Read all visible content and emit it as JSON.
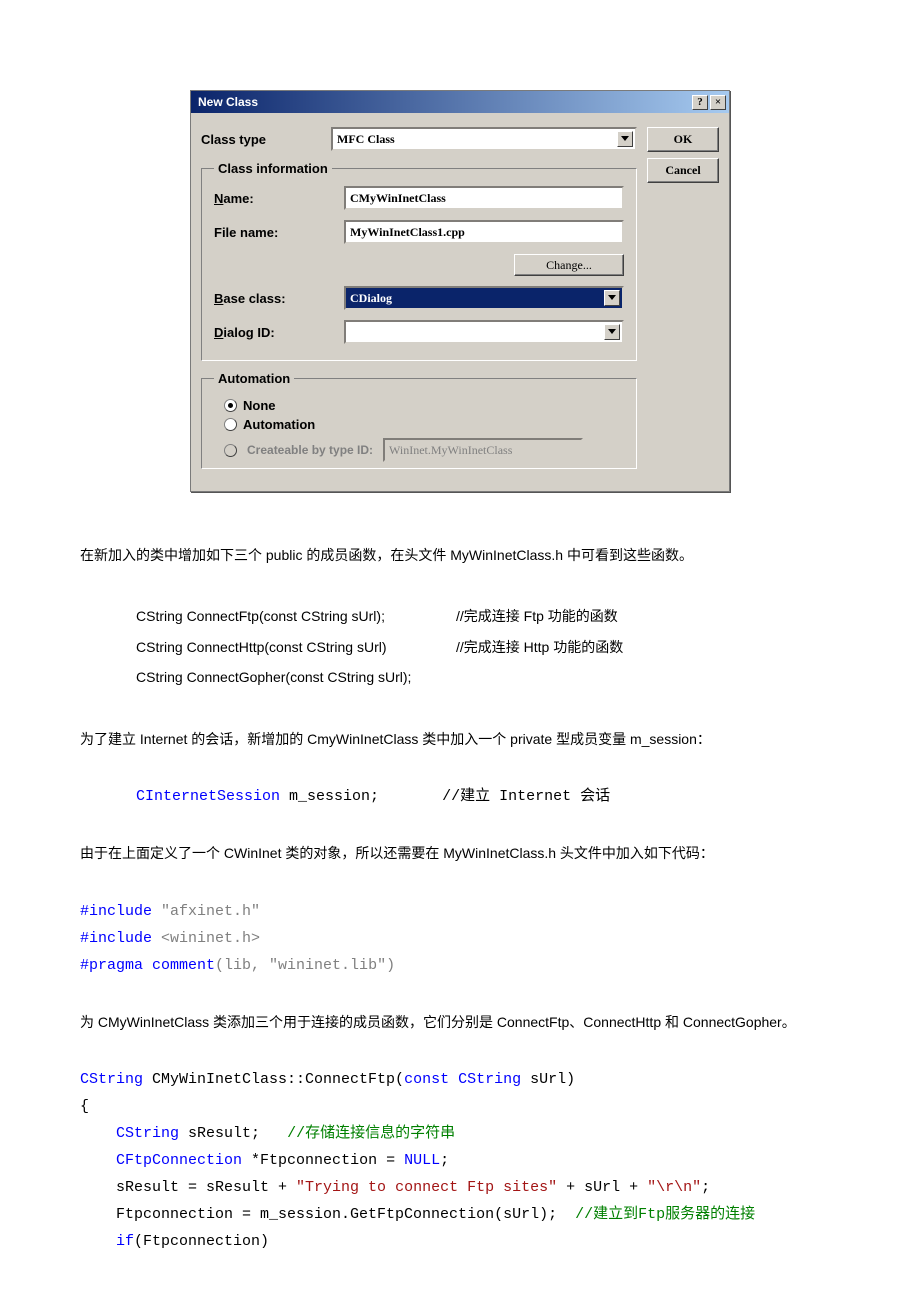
{
  "dialog": {
    "title": "New Class",
    "help_glyph": "?",
    "close_glyph": "×",
    "ok": "OK",
    "cancel": "Cancel",
    "class_type_label": "Class type",
    "class_type_value": "MFC Class",
    "class_info_legend": "Class information",
    "name_label_pre": "N",
    "name_label_rest": "ame:",
    "name_value": "CMyWinInetClass",
    "file_label": "File name:",
    "file_value": "MyWinInetClass1.cpp",
    "change_btn_pre": "C",
    "change_btn_rest": "hange...",
    "base_label_pre": "B",
    "base_label_rest": "ase class:",
    "base_value": "CDialog",
    "dlgid_label_pre": "D",
    "dlgid_label_rest": "ialog ID:",
    "dlgid_value": "",
    "automation_legend": "Automation",
    "radio_none_pre": "N",
    "radio_none_rest": "one",
    "radio_auto_pre": "A",
    "radio_auto_rest": "utomation",
    "radio_create_pre": "C",
    "radio_create_rest": "reateable by type ID:",
    "type_id_value": "WinInet.MyWinInetClass"
  },
  "text": {
    "p1": "在新加入的类中增加如下三个 public 的成员函数，在头文件 MyWinInetClass.h 中可看到这些函数。",
    "fn1_sig": "CString ConnectFtp(const CString sUrl);",
    "fn1_cmt": "//完成连接 Ftp 功能的函数",
    "fn2_sig": "CString ConnectHttp(const CString sUrl)",
    "fn2_cmt": "//完成连接 Http 功能的函数",
    "fn3_sig": "CString ConnectGopher(const CString sUrl);",
    "p2": "为了建立 Internet 的会话，新增加的 CmyWinInetClass 类中加入一个 private 型成员变量 m_session：",
    "sess_type": "CInternetSession",
    "sess_var": " m_session;",
    "sess_cmt": "//建立 Internet 会话",
    "p3": "由于在上面定义了一个 CWinInet 类的对象，所以还需要在 MyWinInetClass.h 头文件中加入如下代码：",
    "inc1_kw": "#include",
    "inc1_arg": " \"afxinet.h\"",
    "inc2_kw": "#include",
    "inc2_arg": " <wininet.h>",
    "prag_kw": "#pragma",
    "prag_rest1": " comment",
    "prag_rest2": "(lib, ",
    "prag_str": "\"wininet.lib\"",
    "prag_rest3": ")",
    "p4": "为 CMyWinInetClass 类添加三个用于连接的成员函数，它们分别是 ConnectFtp、ConnectHttp 和 ConnectGopher。",
    "cf_ret": "CString",
    "cf_name": " CMyWinInetClass::ConnectFtp(",
    "cf_const": "const",
    "cf_arg": " CString",
    "cf_argname": " sUrl)",
    "cf_brace_open": "{",
    "cf_l1_type": "CString",
    "cf_l1_rest": " sResult;   ",
    "cf_l1_cmt": "//存储连接信息的字符串",
    "cf_l2_type": "CFtpConnection",
    "cf_l2_rest": " *Ftpconnection = ",
    "cf_l2_null": "NULL",
    "cf_l2_semi": ";",
    "cf_l3_a": "    sResult = sResult + ",
    "cf_l3_str1": "\"Trying to connect Ftp sites\"",
    "cf_l3_b": " + sUrl + ",
    "cf_l3_str2": "\"\\r\\n\"",
    "cf_l3_c": ";",
    "cf_l4_a": "    Ftpconnection = m_session.GetFtpConnection(sUrl);  ",
    "cf_l4_cmt": "//建立到Ftp服务器的连接",
    "cf_l5_if": "if",
    "cf_l5_rest": "(Ftpconnection)"
  }
}
